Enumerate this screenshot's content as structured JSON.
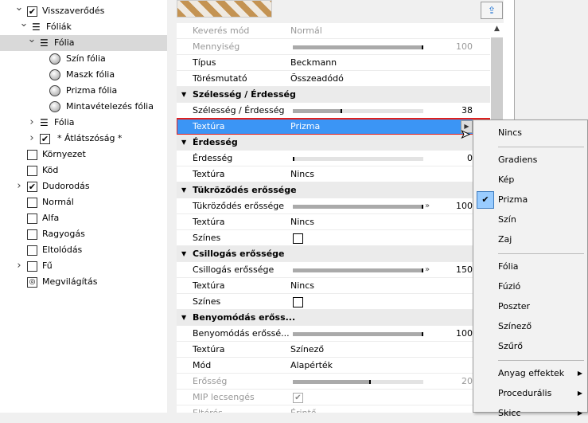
{
  "tree": [
    {
      "label": "Visszaverődés",
      "level": 0,
      "chev": "down",
      "kind": "checkbox",
      "checked": true
    },
    {
      "label": "Fóliák",
      "level": 1,
      "chev": "down",
      "kind": "layers"
    },
    {
      "label": "Fólia",
      "level": 2,
      "chev": "down",
      "kind": "layers",
      "selected": true
    },
    {
      "label": "Szín fólia",
      "level": 3,
      "kind": "ball"
    },
    {
      "label": "Maszk fólia",
      "level": 3,
      "kind": "ball"
    },
    {
      "label": "Prizma fólia",
      "level": 3,
      "kind": "ball"
    },
    {
      "label": "Mintavételezés fólia",
      "level": 3,
      "kind": "ball"
    },
    {
      "label": "Fólia",
      "level": 2,
      "chev": "right",
      "kind": "layers"
    },
    {
      "label": "* Átlátszóság *",
      "level": 2,
      "chev": "right",
      "kind": "checkbox",
      "checked": true
    },
    {
      "label": "Környezet",
      "level": 0,
      "kind": "checkbox",
      "checked": false
    },
    {
      "label": "Köd",
      "level": 0,
      "kind": "checkbox",
      "checked": false
    },
    {
      "label": "Dudorodás",
      "level": 0,
      "chev": "right",
      "kind": "checkbox",
      "checked": true
    },
    {
      "label": "Normál",
      "level": 0,
      "kind": "checkbox",
      "checked": false
    },
    {
      "label": "Alfa",
      "level": 0,
      "kind": "checkbox",
      "checked": false
    },
    {
      "label": "Ragyogás",
      "level": 0,
      "kind": "checkbox",
      "checked": false
    },
    {
      "label": "Eltolódás",
      "level": 0,
      "kind": "checkbox",
      "checked": false
    },
    {
      "label": "Fű",
      "level": 0,
      "chev": "right",
      "kind": "checkbox",
      "checked": false
    },
    {
      "label": "Megvilágítás",
      "level": 0,
      "kind": "light"
    }
  ],
  "properties": [
    {
      "type": "value",
      "name": "Keverés mód",
      "value": "Normál",
      "disabled": true
    },
    {
      "type": "slider",
      "name": "Mennyiség",
      "percent": 100,
      "number": "100",
      "disabled": true
    },
    {
      "type": "value",
      "name": "Típus",
      "value": "Beckmann"
    },
    {
      "type": "value",
      "name": "Törésmutató",
      "value": "Összeadódó"
    },
    {
      "type": "header",
      "name": "Szélesség / Érdesség"
    },
    {
      "type": "slider",
      "name": "Szélesség / Érdesség",
      "percent": 38,
      "number": "38"
    },
    {
      "type": "value",
      "name": "Textúra",
      "value": "Prizma",
      "selected": true
    },
    {
      "type": "header",
      "name": "Érdesség"
    },
    {
      "type": "slider",
      "name": "Érdesség",
      "percent": 0,
      "number": "0"
    },
    {
      "type": "value",
      "name": "Textúra",
      "value": "Nincs"
    },
    {
      "type": "header",
      "name": "Tükröződés erőssége"
    },
    {
      "type": "slider",
      "name": "Tükröződés erőssége",
      "percent": 100,
      "number": "100",
      "more": true
    },
    {
      "type": "value",
      "name": "Textúra",
      "value": "Nincs"
    },
    {
      "type": "check",
      "name": "Színes",
      "checked": false
    },
    {
      "type": "header",
      "name": "Csillogás erőssége"
    },
    {
      "type": "slider",
      "name": "Csillogás erőssége",
      "percent": 100,
      "number": "150",
      "more": true
    },
    {
      "type": "value",
      "name": "Textúra",
      "value": "Nincs"
    },
    {
      "type": "check",
      "name": "Színes",
      "checked": false
    },
    {
      "type": "header",
      "name": "Benyomódás erőss..."
    },
    {
      "type": "slider",
      "name": "Benyomódás erőssé...",
      "percent": 100,
      "number": "100"
    },
    {
      "type": "value",
      "name": "Textúra",
      "value": "Színező"
    },
    {
      "type": "value",
      "name": "Mód",
      "value": "Alapérték"
    },
    {
      "type": "slider",
      "name": "Erősség",
      "percent": 60,
      "number": "20",
      "disabled": true
    },
    {
      "type": "check",
      "name": "MIP lecsengés",
      "checked": true,
      "disabled": true
    },
    {
      "type": "value",
      "name": "Eltérés",
      "value": "Érintő",
      "disabled": true
    }
  ],
  "menu": [
    {
      "label": "Nincs"
    },
    {
      "sep": true
    },
    {
      "label": "Gradiens"
    },
    {
      "label": "Kép"
    },
    {
      "label": "Prizma",
      "checked": true
    },
    {
      "label": "Szín"
    },
    {
      "label": "Zaj"
    },
    {
      "sep": true
    },
    {
      "label": "Fólia"
    },
    {
      "label": "Fúzió"
    },
    {
      "label": "Poszter"
    },
    {
      "label": "Színező"
    },
    {
      "label": "Szűrő"
    },
    {
      "sep": true
    },
    {
      "label": "Anyag effektek",
      "submenu": true
    },
    {
      "label": "Procedurális",
      "submenu": true
    },
    {
      "label": "Skicc",
      "submenu": true
    }
  ],
  "colors": {
    "selection": "#3b95f5",
    "highlight_border": "#e0201e",
    "menu_check": "#99ccff"
  }
}
